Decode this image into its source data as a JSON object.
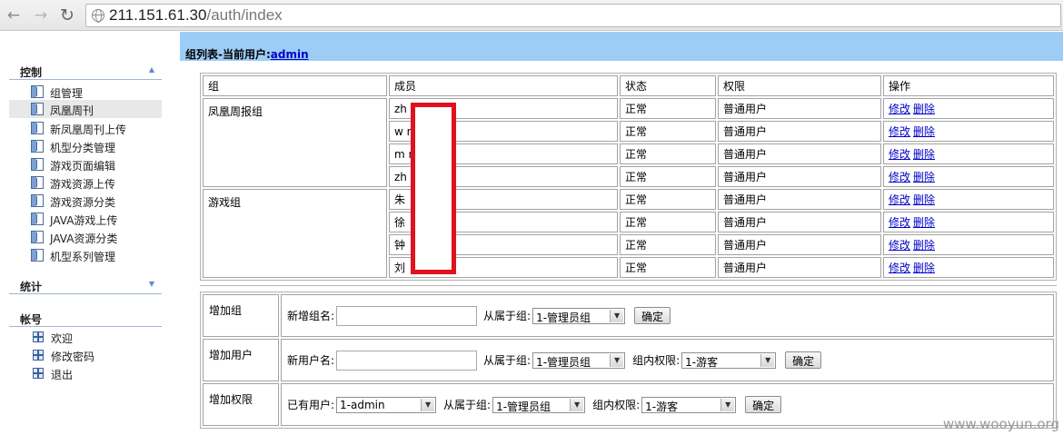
{
  "browser": {
    "url_host": "211.151.61.30",
    "url_path": "/auth/index"
  },
  "sidebar": {
    "control": {
      "title": "控制",
      "items": [
        {
          "label": "组管理"
        },
        {
          "label": "凤凰周刊"
        },
        {
          "label": "新凤凰周刊上传"
        },
        {
          "label": "机型分类管理"
        },
        {
          "label": "游戏页面编辑"
        },
        {
          "label": "游戏资源上传"
        },
        {
          "label": "游戏资源分类"
        },
        {
          "label": "JAVA游戏上传"
        },
        {
          "label": "JAVA资源分类"
        },
        {
          "label": "机型系列管理"
        }
      ]
    },
    "stats": {
      "title": "统计"
    },
    "account": {
      "title": "帐号",
      "items": [
        {
          "label": "欢迎"
        },
        {
          "label": "修改密码"
        },
        {
          "label": "退出"
        }
      ]
    }
  },
  "header": {
    "prefix": "组列表-当前用户:",
    "user": "admin"
  },
  "table": {
    "columns": [
      "组",
      "成员",
      "状态",
      "权限",
      "操作"
    ],
    "groups": [
      {
        "name": "凤凰周报组",
        "rows": [
          {
            "member": "zh      o",
            "status": "正常",
            "perm": "普通用户",
            "edit": "修改",
            "del": "删除"
          },
          {
            "member": "w       ng",
            "status": "正常",
            "perm": "普通用户",
            "edit": "修改",
            "del": "删除"
          },
          {
            "member": "m       n",
            "status": "正常",
            "perm": "普通用户",
            "edit": "修改",
            "del": "删除"
          },
          {
            "member": "zh",
            "status": "正常",
            "perm": "普通用户",
            "edit": "修改",
            "del": "删除"
          }
        ]
      },
      {
        "name": "游戏组",
        "rows": [
          {
            "member": "朱",
            "status": "正常",
            "perm": "普通用户",
            "edit": "修改",
            "del": "删除"
          },
          {
            "member": "徐",
            "status": "正常",
            "perm": "普通用户",
            "edit": "修改",
            "del": "删除"
          },
          {
            "member": "钟",
            "status": "正常",
            "perm": "普通用户",
            "edit": "修改",
            "del": "删除"
          },
          {
            "member": "刘",
            "status": "正常",
            "perm": "普通用户",
            "edit": "修改",
            "del": "删除"
          }
        ]
      }
    ]
  },
  "forms": {
    "add_group": {
      "label": "增加组",
      "name_label": "新增组名:",
      "parent_label": "从属于组:",
      "parent_value": "1-管理员组",
      "confirm": "确定"
    },
    "add_user": {
      "label": "增加用户",
      "name_label": "新用户名:",
      "parent_label": "从属于组:",
      "parent_value": "1-管理员组",
      "perm_label": "组内权限:",
      "perm_value": "1-游客",
      "confirm": "确定"
    },
    "add_perm": {
      "label": "增加权限",
      "user_label": "已有用户:",
      "user_value": "1-admin",
      "parent_label": "从属于组:",
      "parent_value": "1-管理员组",
      "perm_label": "组内权限:",
      "perm_value": "1-游客",
      "confirm": "确定"
    }
  },
  "watermark": "www.wooyun.org",
  "colors": {
    "header_bg": "#9dcdf6",
    "link": "#0000cc",
    "redaction": "#e0121c"
  }
}
